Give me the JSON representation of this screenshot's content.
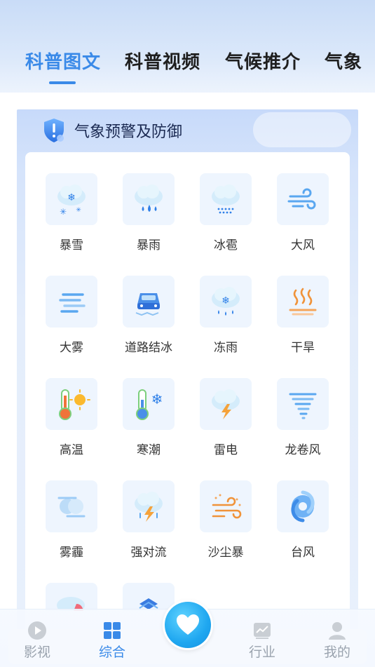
{
  "tabs": [
    {
      "label": "科普图文",
      "active": true
    },
    {
      "label": "科普视频",
      "active": false
    },
    {
      "label": "气候推介",
      "active": false
    },
    {
      "label": "气象",
      "active": false
    }
  ],
  "section": {
    "title": "气象预警及防御",
    "icon": "shield-alert-icon"
  },
  "items": [
    {
      "label": "暴雪",
      "icon": "snowstorm-icon"
    },
    {
      "label": "暴雨",
      "icon": "rainstorm-icon"
    },
    {
      "label": "冰雹",
      "icon": "hail-icon"
    },
    {
      "label": "大风",
      "icon": "gale-icon"
    },
    {
      "label": "大雾",
      "icon": "fog-icon"
    },
    {
      "label": "道路结冰",
      "icon": "road-icing-icon"
    },
    {
      "label": "冻雨",
      "icon": "freezing-rain-icon"
    },
    {
      "label": "干旱",
      "icon": "drought-icon"
    },
    {
      "label": "高温",
      "icon": "heat-icon"
    },
    {
      "label": "寒潮",
      "icon": "cold-wave-icon"
    },
    {
      "label": "雷电",
      "icon": "thunder-icon"
    },
    {
      "label": "龙卷风",
      "icon": "tornado-icon"
    },
    {
      "label": "雾霾",
      "icon": "haze-icon"
    },
    {
      "label": "强对流",
      "icon": "severe-convection-icon"
    },
    {
      "label": "沙尘暴",
      "icon": "sandstorm-icon"
    },
    {
      "label": "台风",
      "icon": "typhoon-icon"
    }
  ],
  "nav": [
    {
      "label": "影视",
      "icon": "play-icon",
      "active": false
    },
    {
      "label": "综合",
      "icon": "grid-icon",
      "active": true
    },
    {
      "label": "行业",
      "icon": "chart-icon",
      "active": false
    },
    {
      "label": "我的",
      "icon": "user-icon",
      "active": false
    }
  ],
  "fab": {
    "icon": "heart-icon"
  },
  "colors": {
    "accent": "#3a8ae8",
    "title": "#1b2a52",
    "inactive_nav": "#9aa3ae"
  }
}
